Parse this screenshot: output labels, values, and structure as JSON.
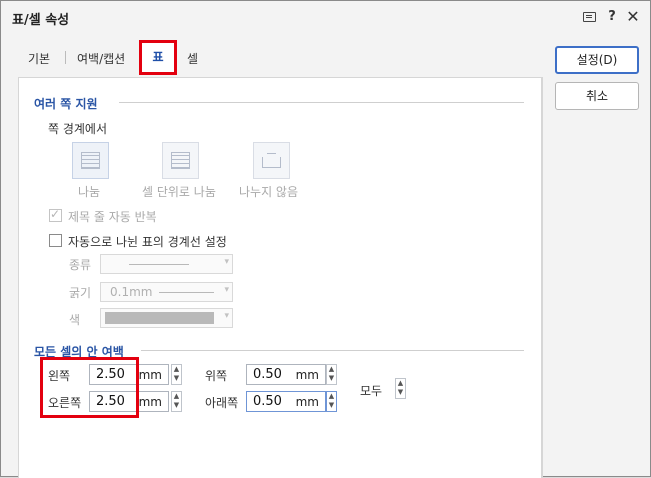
{
  "window": {
    "title": "표/셀 속성"
  },
  "titlebar_icons": {
    "help": "?",
    "close": "✕"
  },
  "tabs": [
    {
      "label": "기본"
    },
    {
      "label": "여백/캡션"
    },
    {
      "label": "표",
      "active": true
    },
    {
      "label": "셀"
    }
  ],
  "multi_page": {
    "title": "여러 쪽 지원",
    "boundary_label": "쪽 경계에서",
    "split_options": [
      {
        "label": "나눔",
        "icon": "split-table-icon",
        "selected": true
      },
      {
        "label": "셀 단위로 나눔",
        "icon": "split-by-cell-icon"
      },
      {
        "label": "나누지 않음",
        "icon": "no-split-icon"
      }
    ],
    "repeat_header": {
      "label": "제목 줄 자동 반복",
      "checked": true,
      "disabled": true
    },
    "auto_border": {
      "label": "자동으로 나뉜 표의 경계선 설정",
      "checked": false
    },
    "kind_label": "종류",
    "thickness_label": "굵기",
    "thickness_value": "0.1mm",
    "color_label": "색"
  },
  "cell_margins": {
    "title": "모든 셀의 안 여백",
    "left": {
      "label": "왼쪽",
      "value": "2.50",
      "unit": "mm"
    },
    "right": {
      "label": "오른쪽",
      "value": "2.50",
      "unit": "mm"
    },
    "top": {
      "label": "위쪽",
      "value": "0.50",
      "unit": "mm"
    },
    "bottom": {
      "label": "아래쪽",
      "value": "0.50",
      "unit": "mm"
    },
    "all": {
      "label": "모두"
    }
  },
  "buttons": {
    "ok": "설정(D)",
    "cancel": "취소"
  },
  "colors": {
    "accent": "#2a55a5",
    "highlight": "#e3000f",
    "primary_border": "#3d6fc7"
  }
}
